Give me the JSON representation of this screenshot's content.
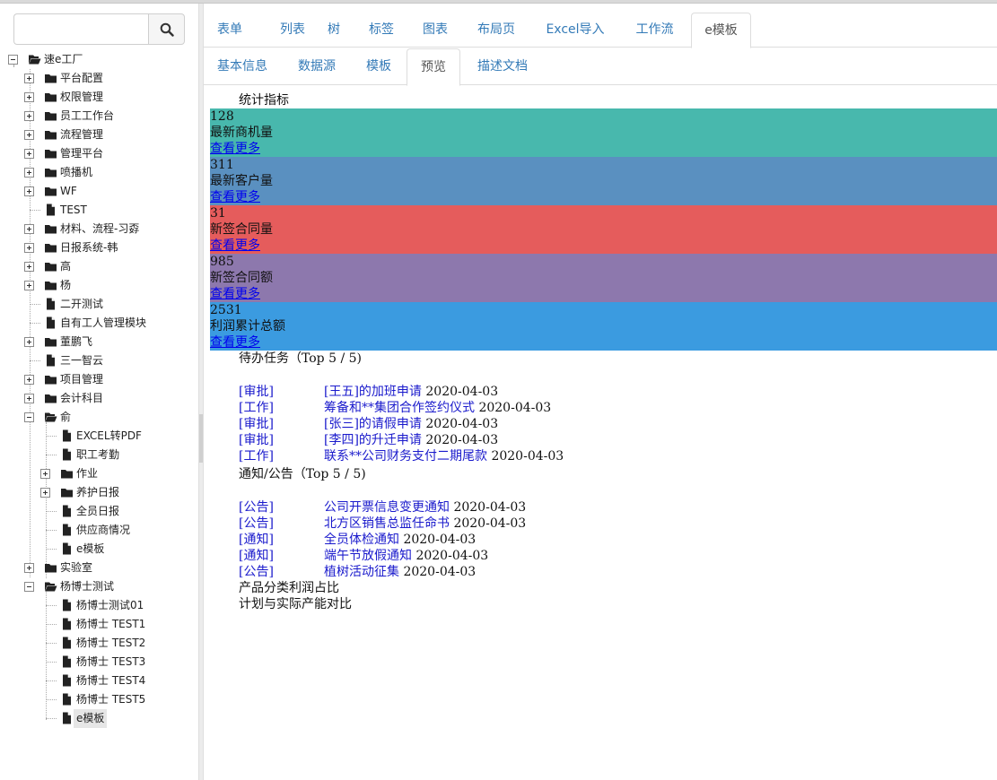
{
  "search": {
    "placeholder": ""
  },
  "tree": [
    {
      "label": "速e工厂",
      "icon": "folder-open",
      "toggle": "minus"
    },
    {
      "label": "平台配置",
      "icon": "folder",
      "toggle": "plus"
    },
    {
      "label": "权限管理",
      "icon": "folder",
      "toggle": "plus"
    },
    {
      "label": "员工工作台",
      "icon": "folder",
      "toggle": "plus"
    },
    {
      "label": "流程管理",
      "icon": "folder",
      "toggle": "plus"
    },
    {
      "label": "管理平台",
      "icon": "folder",
      "toggle": "plus"
    },
    {
      "label": "喷播机",
      "icon": "folder",
      "toggle": "plus"
    },
    {
      "label": "WF",
      "icon": "folder",
      "toggle": "plus"
    },
    {
      "label": "TEST",
      "icon": "file",
      "toggle": "none"
    },
    {
      "label": "材料、流程-习孬",
      "icon": "folder",
      "toggle": "plus"
    },
    {
      "label": "日报系统-韩",
      "icon": "folder",
      "toggle": "plus"
    },
    {
      "label": "高",
      "icon": "folder",
      "toggle": "plus"
    },
    {
      "label": "杨",
      "icon": "folder",
      "toggle": "plus"
    },
    {
      "label": "二开测试",
      "icon": "file",
      "toggle": "none"
    },
    {
      "label": "自有工人管理模块",
      "icon": "file",
      "toggle": "none"
    },
    {
      "label": "董鹏飞",
      "icon": "folder",
      "toggle": "plus"
    },
    {
      "label": "三一智云",
      "icon": "file",
      "toggle": "none"
    },
    {
      "label": "项目管理",
      "icon": "folder",
      "toggle": "plus"
    },
    {
      "label": "会计科目",
      "icon": "folder",
      "toggle": "plus"
    },
    {
      "label": "俞",
      "icon": "folder-open",
      "toggle": "minus"
    },
    {
      "label": "EXCEL转PDF",
      "icon": "file",
      "toggle": "none"
    },
    {
      "label": "职工考勤",
      "icon": "file",
      "toggle": "none"
    },
    {
      "label": "作业",
      "icon": "folder",
      "toggle": "plus"
    },
    {
      "label": "养护日报",
      "icon": "folder",
      "toggle": "plus"
    },
    {
      "label": "全员日报",
      "icon": "file",
      "toggle": "none"
    },
    {
      "label": "供应商情况",
      "icon": "file",
      "toggle": "none"
    },
    {
      "label": "e模板",
      "icon": "file",
      "toggle": "none"
    },
    {
      "label": "实验室",
      "icon": "folder",
      "toggle": "plus"
    },
    {
      "label": "杨博士测试",
      "icon": "folder-open",
      "toggle": "minus"
    },
    {
      "label": "杨博士测试01",
      "icon": "file",
      "toggle": "none"
    },
    {
      "label": "杨博士 TEST1",
      "icon": "file",
      "toggle": "none"
    },
    {
      "label": "杨博士 TEST2",
      "icon": "file",
      "toggle": "none"
    },
    {
      "label": "杨博士 TEST3",
      "icon": "file",
      "toggle": "none"
    },
    {
      "label": "杨博士 TEST4",
      "icon": "file",
      "toggle": "none"
    },
    {
      "label": "杨博士 TEST5",
      "icon": "file",
      "toggle": "none"
    },
    {
      "label": "e模板",
      "icon": "file",
      "toggle": "none",
      "selected": true
    }
  ],
  "main_tabs": [
    "表单",
    "列表",
    "树",
    "标签",
    "图表",
    "布局页",
    "Excel导入",
    "工作流",
    "e模板"
  ],
  "main_tab_active": "e模板",
  "sub_tabs": [
    "基本信息",
    "数据源",
    "模板",
    "预览",
    "描述文档"
  ],
  "sub_tab_active": "预览",
  "stats_title": "统计指标",
  "stats": [
    {
      "value": "128",
      "label": "最新商机量",
      "link": "查看更多",
      "color": "#48b8ad"
    },
    {
      "value": "311",
      "label": "最新客户量",
      "link": "查看更多",
      "color": "#5a90c0"
    },
    {
      "value": "31",
      "label": "新签合同量",
      "link": "查看更多",
      "color": "#e55c5c"
    },
    {
      "value": "985",
      "label": "新签合同额",
      "link": "查看更多",
      "color": "#8d78ad"
    },
    {
      "value": "2531",
      "label": "利润累计总额",
      "link": "查看更多",
      "color": "#3b9be0"
    }
  ],
  "todo_title": "待办任务（Top 5 / 5)",
  "todos": [
    {
      "tag": "[审批]",
      "title": "[王五]的加班申请",
      "date": "2020-04-03"
    },
    {
      "tag": "[工作]",
      "title": "筹备和**集团合作签约仪式",
      "date": "2020-04-03"
    },
    {
      "tag": "[审批]",
      "title": "[张三]的请假申请",
      "date": "2020-04-03"
    },
    {
      "tag": "[审批]",
      "title": "[李四]的升迁申请",
      "date": "2020-04-03"
    },
    {
      "tag": "[工作]",
      "title": "联系**公司财务支付二期尾款",
      "date": "2020-04-03"
    }
  ],
  "notice_title": "通知/公告（Top 5 / 5)",
  "notices": [
    {
      "tag": "[公告]",
      "title": "公司开票信息变更通知",
      "date": "2020-04-03"
    },
    {
      "tag": "[公告]",
      "title": "北方区销售总监任命书",
      "date": "2020-04-03"
    },
    {
      "tag": "[通知]",
      "title": "全员体检通知",
      "date": "2020-04-03"
    },
    {
      "tag": "[通知]",
      "title": "端午节放假通知",
      "date": "2020-04-03"
    },
    {
      "tag": "[公告]",
      "title": "植树活动征集",
      "date": "2020-04-03"
    }
  ],
  "chart1_title": "产品分类利润占比",
  "chart2_title": "计划与实际产能对比"
}
